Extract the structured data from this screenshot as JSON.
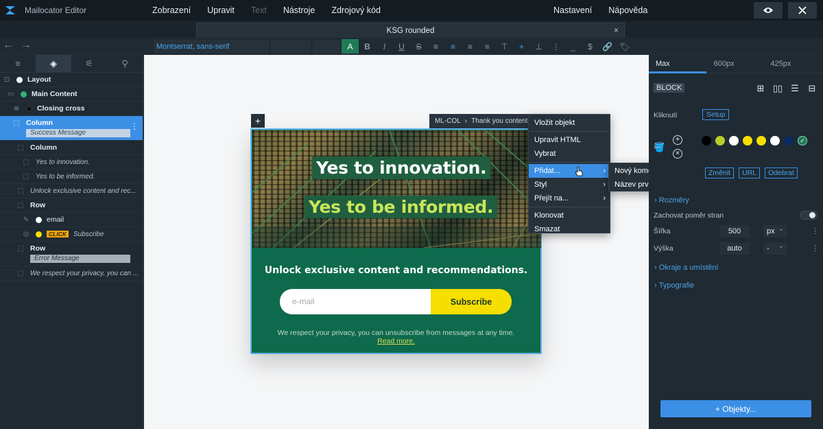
{
  "app": {
    "title": "Mailocator Editor",
    "menu": [
      "Zobrazení",
      "Upravit",
      "Text",
      "Nástroje",
      "Zdrojový kód"
    ],
    "right_menu": [
      "Nastavení",
      "Nápověda"
    ],
    "accent_color": "#3b8fe5"
  },
  "tab": {
    "title": "KSG rounded",
    "close": "×"
  },
  "toolbar": {
    "back": "←",
    "forward": "→",
    "font_family": "Montserrat, sans-serif",
    "format_icons": [
      "A",
      "B",
      "I",
      "U",
      "S",
      "≡",
      "≡",
      "≡",
      "≡",
      "⊤",
      "+",
      "⊥",
      "⋮",
      "_",
      "$",
      "🔗",
      "🏷"
    ]
  },
  "left_panel": {
    "tabs": [
      "≡",
      "◈",
      "⚟",
      "⚲"
    ],
    "tree": [
      {
        "label": "Layout",
        "dot": "#ffffff",
        "icon": "⊡"
      },
      {
        "label": "Main Content",
        "dot": "#2fb37a",
        "icon": "▭"
      },
      {
        "label": "Closing cross",
        "dot": "#111111",
        "icon": "⊗"
      },
      {
        "label": "Column",
        "tag": "Success Message",
        "icon": "⬚"
      },
      {
        "label": "Column",
        "icon": "⬚"
      },
      {
        "label": "Yes to innovation.",
        "icon": "⬚"
      },
      {
        "label": "Yes to be informed.",
        "icon": "⬚"
      },
      {
        "label": "Unlock exclusive content and rec...",
        "icon": "⬚"
      },
      {
        "label": "Row",
        "icon": "⬚"
      },
      {
        "label": "email",
        "dot": "#ffffff",
        "icon": "✎"
      },
      {
        "label": "Subscribe",
        "dot": "#f6df00",
        "badge": "CLICK",
        "icon": "◎"
      },
      {
        "label": "Row",
        "tag": "Error Message",
        "icon": "⬚"
      },
      {
        "label": "We respect your privacy, you can ...",
        "icon": "⬚"
      }
    ]
  },
  "canvas": {
    "add": "+",
    "breadcrumb": [
      "ML-COL",
      "›",
      "Thank you content"
    ],
    "headline1": "Yes to innovation.",
    "headline2": "Yes to be informed.",
    "subheadline": "Unlock exclusive content and recommendations.",
    "email_placeholder": "e-mail",
    "subscribe_label": "Subscribe",
    "privacy_text": "We respect your privacy, you can unsubscribe from messages at any time.",
    "read_more": "Read more.",
    "card_color": "#0e6a4c",
    "button_color": "#f6df00"
  },
  "context_menu": {
    "items": [
      "Vložit objekt",
      "Upravit HTML",
      "Vybrat",
      "Přidat...",
      "Styl",
      "Přejít na...",
      "Klonovat",
      "Smazat"
    ],
    "submenu": [
      "Nový komentář",
      "Název prvku"
    ]
  },
  "right_panel": {
    "breakpoints": [
      "Max",
      "600px",
      "425px"
    ],
    "block_badge": "BLOCK",
    "layout_icons": [
      "⊞",
      "▯▯",
      "☰",
      "⊟"
    ],
    "click_label": "Kliknutí",
    "setup_label": "Setup",
    "fill_icon": "🪣",
    "color_add": "+",
    "color_remove": "×",
    "swatches": [
      "#000000",
      "#b9cc2a",
      "#ffffff",
      "#f6df00",
      "#f6df00",
      "#ffffff",
      "#0b2a5e",
      "#1f7a57"
    ],
    "swatch_selected_mark": "✓",
    "link_buttons": [
      "Změnit",
      "URL",
      "Odebrat"
    ],
    "sections": {
      "dimensions": "Rozměry",
      "borders": "Okraje a umístění",
      "typography": "Typografie"
    },
    "keep_ratio": "Zachovat poměr stran",
    "width_label": "Šířka",
    "width_value": "500",
    "width_unit": "px",
    "height_label": "Výška",
    "height_value": "auto",
    "height_unit": "-",
    "more": "⋮",
    "objects_button": "+ Objekty..."
  }
}
